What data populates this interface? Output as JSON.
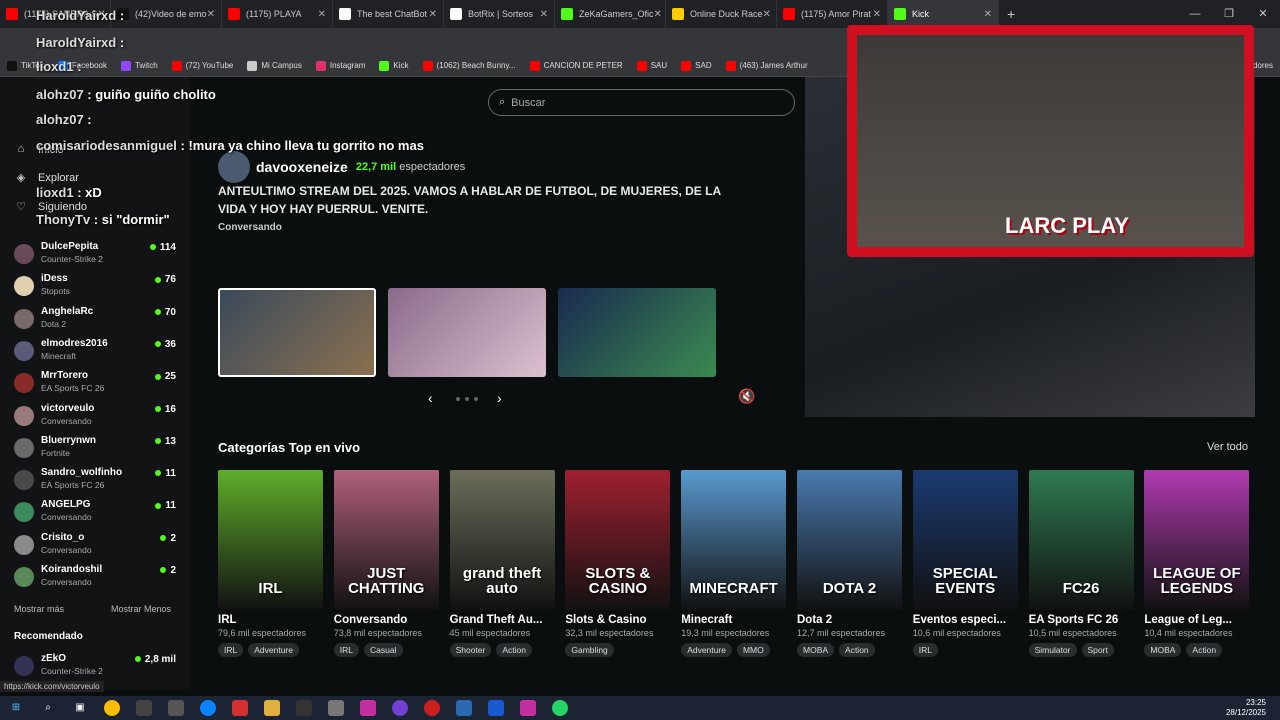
{
  "tabs": [
    {
      "label": "(1175) SANDRA S",
      "color": "#ff0000"
    },
    {
      "label": "(42)Video de emo",
      "color": "#111111"
    },
    {
      "label": "(1175) PLAYA",
      "color": "#ff0000"
    },
    {
      "label": "The best ChatBot",
      "color": "#ffffff"
    },
    {
      "label": "BotRix | Sorteos",
      "color": "#ffffff"
    },
    {
      "label": "ZeKaGamers_Ofic",
      "color": "#53fc18"
    },
    {
      "label": "Online Duck Race",
      "color": "#ffcc00"
    },
    {
      "label": "(1175) Amor Pirat",
      "color": "#ff0000"
    },
    {
      "label": "Kick",
      "color": "#53fc18"
    }
  ],
  "bookmarks": [
    {
      "label": "TikTok",
      "color": "#111111"
    },
    {
      "label": "Facebook",
      "color": "#1877f2"
    },
    {
      "label": "Twitch",
      "color": "#9146ff"
    },
    {
      "label": "(72) YouTube",
      "color": "#ff0000"
    },
    {
      "label": "Mi Campus",
      "color": "#cccccc"
    },
    {
      "label": "Instagram",
      "color": "#e1306c"
    },
    {
      "label": "Kick",
      "color": "#53fc18"
    },
    {
      "label": "(1062) Beach Bunny...",
      "color": "#ff0000"
    },
    {
      "label": "CANCION DE PETER",
      "color": "#ff0000"
    },
    {
      "label": "SAU",
      "color": "#ff0000"
    },
    {
      "label": "SAD",
      "color": "#ff0000"
    },
    {
      "label": "(463) James Arthur",
      "color": "#ff0000"
    }
  ],
  "bookmarks_more": "Todos los marcadores",
  "search_placeholder": "Buscar",
  "nav": {
    "inicio": "Inicio",
    "explorar": "Explorar",
    "siguiendo": "Siguiendo"
  },
  "channels": [
    {
      "name": "DulcePepita",
      "game": "Counter-Strike 2",
      "viewers": "114"
    },
    {
      "name": "iDess",
      "game": "Stopots",
      "viewers": "76"
    },
    {
      "name": "AnghelaRc",
      "game": "Dota 2",
      "viewers": "70"
    },
    {
      "name": "elmodres2016",
      "game": "Minecraft",
      "viewers": "36"
    },
    {
      "name": "MrrTorero",
      "game": "EA Sports FC 26",
      "viewers": "25"
    },
    {
      "name": "victorveulo",
      "game": "Conversando",
      "viewers": "16"
    },
    {
      "name": "Bluerrynwn",
      "game": "Fortnite",
      "viewers": "13"
    },
    {
      "name": "Sandro_wolfinho",
      "game": "EA Sports FC 26",
      "viewers": "11"
    },
    {
      "name": "ANGELPG",
      "game": "Conversando",
      "viewers": "11"
    },
    {
      "name": "Crisito_o",
      "game": "Conversando",
      "viewers": "2"
    },
    {
      "name": "Koirandoshil",
      "game": "Conversando",
      "viewers": "2"
    }
  ],
  "show_more": "Mostrar más",
  "show_less": "Mostrar Menos",
  "recommended_title": "Recomendado",
  "recommended": {
    "name": "zEkO",
    "game": "Counter-Strike 2",
    "viewers": "2,8 mil"
  },
  "featured": {
    "streamer": "davooxeneize",
    "viewers": "22,7 mil",
    "viewers_label": "espectadores",
    "title": "ANTEULTIMO STREAM DEL 2025. VAMOS A HABLAR DE FUTBOL, DE MUJERES, DE LA VIDA Y HOY HAY PUERRUL. VENITE.",
    "category": "Conversando"
  },
  "overlay_logo": "LARC PLAY",
  "categories_title": "Categorías Top en vivo",
  "see_all": "Ver todo",
  "categories": [
    {
      "cover": "IRL",
      "name": "IRL",
      "viewers": "79,6 mil espectadores",
      "tags": [
        "IRL",
        "Adventure"
      ],
      "color": "#5fae2a"
    },
    {
      "cover": "JUST CHATTING",
      "name": "Conversando",
      "viewers": "73,8 mil espectadores",
      "tags": [
        "IRL",
        "Casual"
      ],
      "color": "#b0607a"
    },
    {
      "cover": "grand theft auto",
      "name": "Grand Theft Au...",
      "viewers": "45 mil espectadores",
      "tags": [
        "Shooter",
        "Action"
      ],
      "color": "#6c6e5a"
    },
    {
      "cover": "SLOTS & CASINO",
      "name": "Slots & Casino",
      "viewers": "32,3 mil espectadores",
      "tags": [
        "Gambling"
      ],
      "color": "#a02030"
    },
    {
      "cover": "MINECRAFT",
      "name": "Minecraft",
      "viewers": "19,3 mil espectadores",
      "tags": [
        "Adventure",
        "MMO"
      ],
      "color": "#5a9ad0"
    },
    {
      "cover": "DOTA 2",
      "name": "Dota 2",
      "viewers": "12,7 mil espectadores",
      "tags": [
        "MOBA",
        "Action"
      ],
      "color": "#4a7ab0"
    },
    {
      "cover": "SPECIAL EVENTS",
      "name": "Eventos especi...",
      "viewers": "10,6 mil espectadores",
      "tags": [
        "IRL"
      ],
      "color": "#1a3a70"
    },
    {
      "cover": "FC26",
      "name": "EA Sports FC 26",
      "viewers": "10,5 mil espectadores",
      "tags": [
        "Simulator",
        "Sport"
      ],
      "color": "#2e7a50"
    },
    {
      "cover": "LEAGUE OF LEGENDS",
      "name": "League of Leg...",
      "viewers": "10,4 mil espectadores",
      "tags": [
        "MOBA",
        "Action"
      ],
      "color": "#b03ab0"
    }
  ],
  "chat": [
    {
      "user": "HaroldYairxd",
      "msg": ""
    },
    {
      "user": "HaroldYairxd",
      "msg": ""
    },
    {
      "user": "lioxd1",
      "msg": ""
    },
    {
      "user": "alohz07",
      "msg": "guiño guiño cholito"
    },
    {
      "user": "alohz07",
      "msg": ""
    },
    {
      "user": "comisariodesanmiguel",
      "msg": "!mura ya chino lleva tu gorrito no mas"
    },
    {
      "user": "lioxd1",
      "msg": "xD"
    },
    {
      "user": "ThonyTv",
      "msg": "si \"dormir\""
    }
  ],
  "status_url": "https://kick.com/victorveulo",
  "clock": {
    "time": "23:25",
    "date": "28/12/2025"
  }
}
